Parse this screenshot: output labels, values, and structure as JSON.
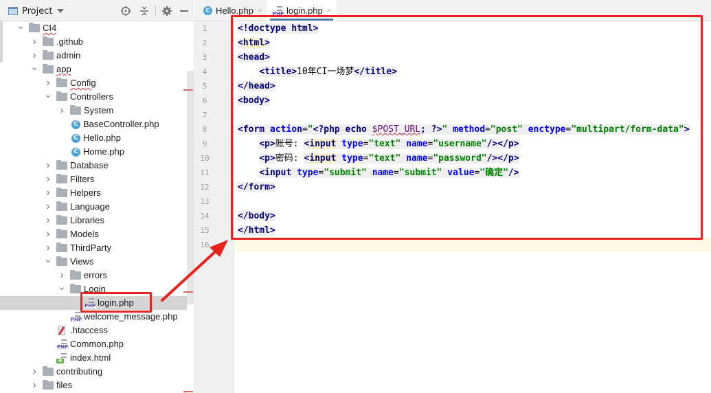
{
  "project_panel": {
    "title": "Project",
    "header_buttons": [
      "locate-icon",
      "collapse-all-icon",
      "gear-icon",
      "minimize-icon"
    ],
    "tree": [
      {
        "label": "CI4",
        "type": "folder",
        "depth": 0,
        "expanded": true,
        "squiggle": true
      },
      {
        "label": ".github",
        "type": "folder",
        "depth": 1,
        "expanded": false
      },
      {
        "label": "admin",
        "type": "folder",
        "depth": 1,
        "expanded": false
      },
      {
        "label": "app",
        "type": "folder",
        "depth": 1,
        "expanded": true,
        "squiggle": true
      },
      {
        "label": "Config",
        "type": "folder",
        "depth": 2,
        "expanded": false,
        "squiggle": true
      },
      {
        "label": "Controllers",
        "type": "folder",
        "depth": 2,
        "expanded": true
      },
      {
        "label": "System",
        "type": "folder",
        "depth": 3,
        "expanded": false
      },
      {
        "label": "BaseController.php",
        "type": "class",
        "depth": 3
      },
      {
        "label": "Hello.php",
        "type": "class",
        "depth": 3
      },
      {
        "label": "Home.php",
        "type": "class",
        "depth": 3
      },
      {
        "label": "Database",
        "type": "folder",
        "depth": 2,
        "expanded": false
      },
      {
        "label": "Filters",
        "type": "folder",
        "depth": 2,
        "expanded": false
      },
      {
        "label": "Helpers",
        "type": "folder",
        "depth": 2,
        "expanded": false
      },
      {
        "label": "Language",
        "type": "folder",
        "depth": 2,
        "expanded": false
      },
      {
        "label": "Libraries",
        "type": "folder",
        "depth": 2,
        "expanded": false
      },
      {
        "label": "Models",
        "type": "folder",
        "depth": 2,
        "expanded": false
      },
      {
        "label": "ThirdParty",
        "type": "folder",
        "depth": 2,
        "expanded": false
      },
      {
        "label": "Views",
        "type": "folder",
        "depth": 2,
        "expanded": true
      },
      {
        "label": "errors",
        "type": "folder",
        "depth": 3,
        "expanded": false
      },
      {
        "label": "Login",
        "type": "folder",
        "depth": 3,
        "expanded": true
      },
      {
        "label": "login.php",
        "type": "php",
        "depth": 4,
        "selected": true
      },
      {
        "label": "welcome_message.php",
        "type": "php",
        "depth": 3
      },
      {
        "label": ".htaccess",
        "type": "htaccess",
        "depth": 2
      },
      {
        "label": "Common.php",
        "type": "php",
        "depth": 2
      },
      {
        "label": "index.html",
        "type": "html",
        "depth": 2
      },
      {
        "label": "contributing",
        "type": "folder",
        "depth": 1,
        "expanded": false
      },
      {
        "label": "files",
        "type": "folder",
        "depth": 1,
        "expanded": false
      }
    ]
  },
  "editor": {
    "tabs": [
      {
        "label": "Hello.php",
        "icon": "class",
        "active": false
      },
      {
        "label": "login.php",
        "icon": "php",
        "active": true
      }
    ],
    "close_glyph": "×",
    "current_line": 16,
    "lines": [
      {
        "n": "1",
        "text": "<!doctype html>"
      },
      {
        "n": "2",
        "text": "<html>"
      },
      {
        "n": "3",
        "text": "<head>"
      },
      {
        "n": "4",
        "text": "    <title>10年CI一场梦</title>"
      },
      {
        "n": "5",
        "text": "</head>"
      },
      {
        "n": "6",
        "text": "<body>"
      },
      {
        "n": "7",
        "text": ""
      },
      {
        "n": "8",
        "text": "<form action=\"<?php echo $POST_URL; ?>\" method=\"post\" enctype=\"multipart/form-data\">"
      },
      {
        "n": "9",
        "text": "    <p>账号: <input type=\"text\" name=\"username\"/></p>"
      },
      {
        "n": "10",
        "text": "    <p>密码: <input type=\"text\" name=\"password\"/></p>"
      },
      {
        "n": "11",
        "text": "    <input type=\"submit\" name=\"submit\" value=\"确定\"/>"
      },
      {
        "n": "12",
        "text": "</form>"
      },
      {
        "n": "13",
        "text": ""
      },
      {
        "n": "14",
        "text": "</body>"
      },
      {
        "n": "15",
        "text": "</html>"
      },
      {
        "n": "16",
        "text": ""
      }
    ],
    "tokens": {
      "l1": [
        [
          "tg",
          "<!doctype "
        ],
        [
          "tg",
          "html"
        ],
        [
          "tg",
          ">"
        ]
      ],
      "l2": [
        [
          "tg",
          "<"
        ],
        [
          "tg hl-yellow",
          "html"
        ],
        [
          "tg",
          ">"
        ]
      ],
      "l3": [
        [
          "tg",
          "<head>"
        ]
      ],
      "l4": [
        [
          "txt",
          "    "
        ],
        [
          "tg",
          "<title>"
        ],
        [
          "txt",
          "10年CI一场梦"
        ],
        [
          "tg",
          "</title>"
        ]
      ],
      "l5": [
        [
          "tg",
          "</head>"
        ]
      ],
      "l6": [
        [
          "tg",
          "<body>"
        ]
      ],
      "l8": [
        [
          "tg",
          "<form "
        ],
        [
          "at",
          "action"
        ],
        [
          "pl",
          "="
        ],
        [
          "av",
          "\""
        ],
        [
          "ph",
          "<?php echo "
        ],
        [
          "var-squiggle",
          "$POST_URL"
        ],
        [
          "ph",
          "; ?>"
        ],
        [
          "av",
          "\""
        ],
        [
          "pl",
          " "
        ],
        [
          "at",
          "method"
        ],
        [
          "pl",
          "="
        ],
        [
          "av",
          "\"post\""
        ],
        [
          "pl",
          " "
        ],
        [
          "at",
          "enctype"
        ],
        [
          "pl",
          "="
        ],
        [
          "av",
          "\"multipart/form-data\""
        ],
        [
          "tg",
          ">"
        ]
      ],
      "l9": [
        [
          "txt",
          "    "
        ],
        [
          "tg",
          "<p>"
        ],
        [
          "txt",
          "账号: "
        ],
        [
          "tg",
          "<"
        ],
        [
          "tg hl-yellow",
          "input"
        ],
        [
          "pl",
          " "
        ],
        [
          "at",
          "type"
        ],
        [
          "pl",
          "="
        ],
        [
          "av",
          "\"text\""
        ],
        [
          "pl",
          " "
        ],
        [
          "at",
          "name"
        ],
        [
          "pl",
          "="
        ],
        [
          "av",
          "\"username\""
        ],
        [
          "tg",
          "/></p>"
        ]
      ],
      "l10": [
        [
          "txt",
          "    "
        ],
        [
          "tg",
          "<p>"
        ],
        [
          "txt",
          "密码: "
        ],
        [
          "tg",
          "<"
        ],
        [
          "tg hl-yellow",
          "input"
        ],
        [
          "pl",
          " "
        ],
        [
          "at",
          "type"
        ],
        [
          "pl",
          "="
        ],
        [
          "av",
          "\"text\""
        ],
        [
          "pl",
          " "
        ],
        [
          "at",
          "name"
        ],
        [
          "pl",
          "="
        ],
        [
          "av",
          "\"password\""
        ],
        [
          "tg",
          "/></p>"
        ]
      ],
      "l11": [
        [
          "txt",
          "    "
        ],
        [
          "tg",
          "<input "
        ],
        [
          "at",
          "type"
        ],
        [
          "pl",
          "="
        ],
        [
          "av",
          "\"submit\""
        ],
        [
          "pl",
          " "
        ],
        [
          "at",
          "name"
        ],
        [
          "pl",
          "="
        ],
        [
          "av",
          "\"submit\""
        ],
        [
          "pl",
          " "
        ],
        [
          "at",
          "value"
        ],
        [
          "pl",
          "="
        ],
        [
          "av",
          "\"确定\""
        ],
        [
          "tg",
          "/>"
        ]
      ],
      "l12": [
        [
          "tg",
          "</form>"
        ]
      ],
      "l14": [
        [
          "tg",
          "</body>"
        ]
      ],
      "l15": [
        [
          "tg",
          "</html>"
        ]
      ]
    },
    "fold_lines": [
      2,
      3,
      5,
      6,
      8,
      12,
      14,
      15
    ]
  },
  "annotations": {
    "color": "#e8231d"
  }
}
